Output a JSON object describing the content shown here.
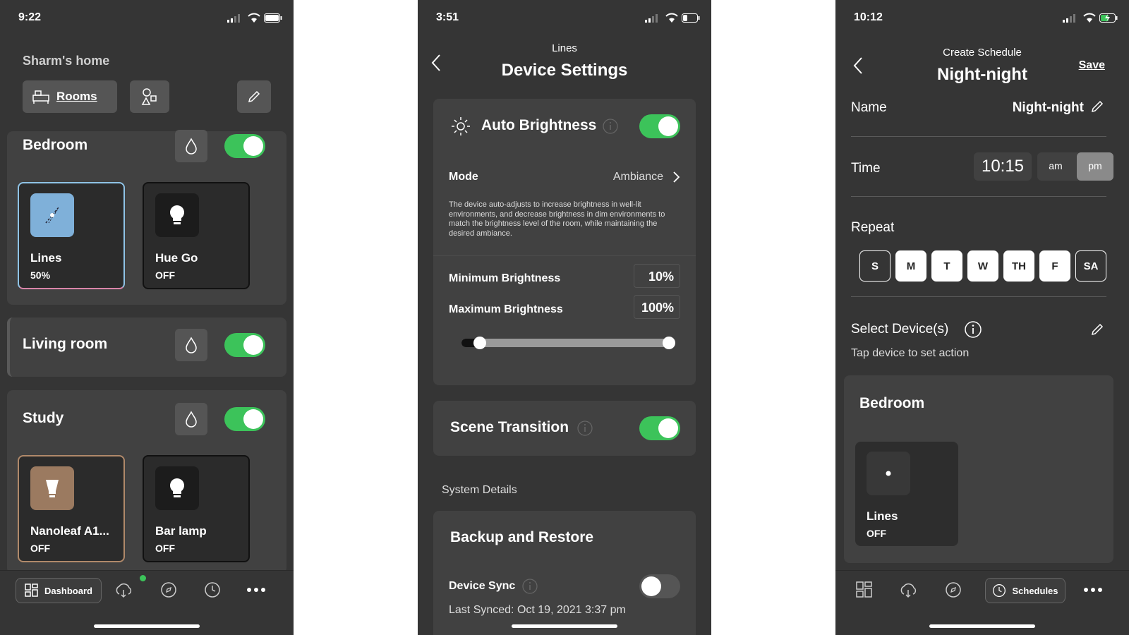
{
  "colors": {
    "green": "#3cc35a",
    "panel": "#353535",
    "card": "#414141"
  },
  "screen1": {
    "status_time": "9:22",
    "home_title": "Sharm's home",
    "rooms_label": "Rooms",
    "rooms": [
      {
        "name": "Bedroom",
        "on": true,
        "devices": [
          {
            "name": "Lines",
            "state": "50%"
          },
          {
            "name": "Hue Go",
            "state": "OFF"
          }
        ]
      },
      {
        "name": "Living room",
        "on": true,
        "devices": []
      },
      {
        "name": "Study",
        "on": true,
        "devices": [
          {
            "name": "Nanoleaf A1...",
            "state": "OFF"
          },
          {
            "name": "Bar lamp",
            "state": "OFF"
          }
        ]
      }
    ],
    "tab_dashboard": "Dashboard"
  },
  "screen2": {
    "status_time": "3:51",
    "subtitle": "Lines",
    "title": "Device Settings",
    "auto_brightness_label": "Auto Brightness",
    "mode_label": "Mode",
    "mode_value": "Ambiance",
    "description": "The device auto-adjusts to increase brightness in well-lit environments, and decrease brightness in dim environments to match the brightness level of the room, while maintaining the desired ambiance.",
    "min_brightness_label": "Minimum Brightness",
    "min_brightness_value": "10%",
    "max_brightness_label": "Maximum Brightness",
    "max_brightness_value": "100%",
    "range": {
      "min": 0.1,
      "max": 1.0
    },
    "scene_transition_label": "Scene Transition",
    "system_details_label": "System Details",
    "backup_label": "Backup and Restore",
    "device_sync_label": "Device Sync",
    "last_synced": "Last Synced: Oct 19, 2021 3:37 pm"
  },
  "screen3": {
    "status_time": "10:12",
    "subtitle": "Create Schedule",
    "title": "Night-night",
    "save_label": "Save",
    "name_label": "Name",
    "name_value": "Night-night",
    "time_label": "Time",
    "time_value": "10:15",
    "am_label": "am",
    "pm_label": "pm",
    "repeat_label": "Repeat",
    "days": [
      "S",
      "M",
      "T",
      "W",
      "TH",
      "F",
      "SA"
    ],
    "select_devices_label": "Select Device(s)",
    "select_devices_hint": "Tap device to set action",
    "room_name": "Bedroom",
    "device_name": "Lines",
    "device_state": "OFF",
    "tab_schedules": "Schedules"
  }
}
